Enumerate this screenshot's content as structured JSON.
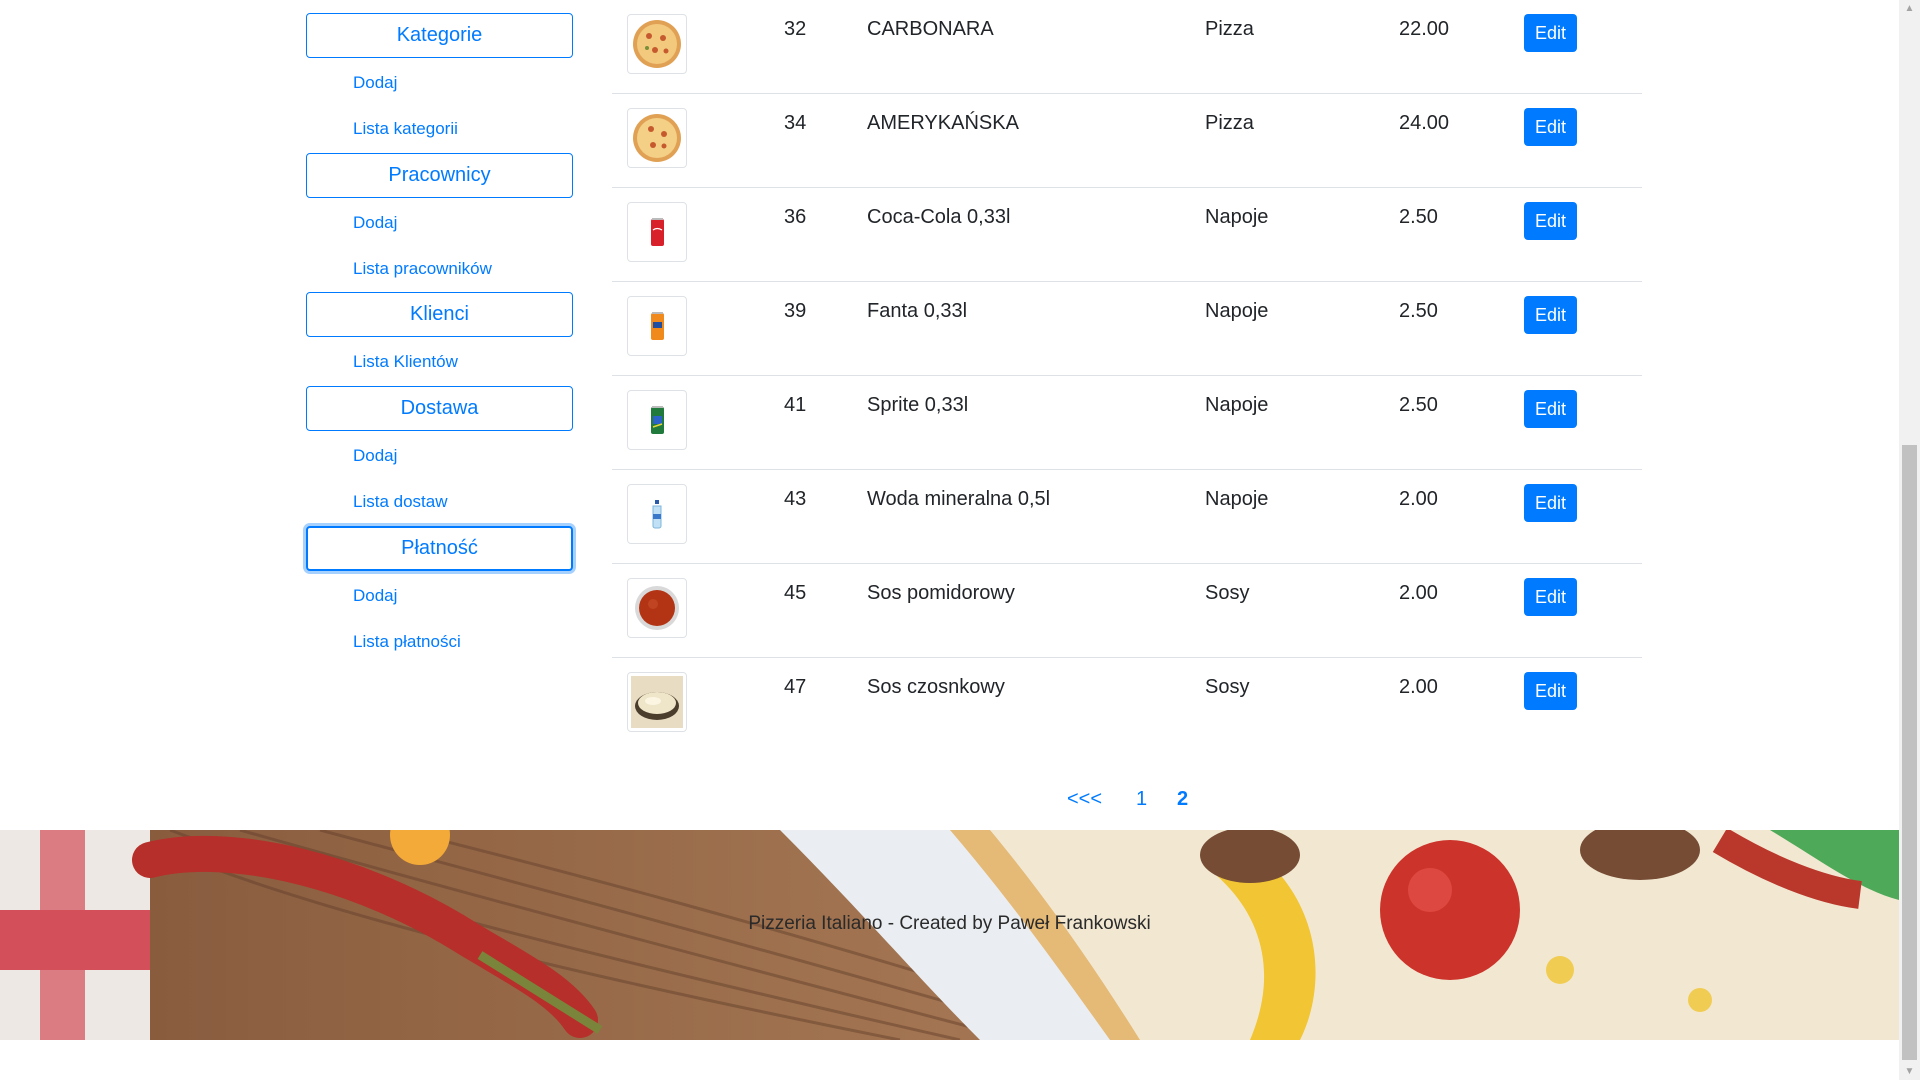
{
  "sidebar": {
    "sections": [
      {
        "label": "Kategorie",
        "links": [
          "Dodaj",
          "Lista kategorii"
        ]
      },
      {
        "label": "Pracownicy",
        "links": [
          "Dodaj",
          "Lista pracowników"
        ]
      },
      {
        "label": "Klienci",
        "links": [
          "Lista Klientów"
        ]
      },
      {
        "label": "Dostawa",
        "links": [
          "Dodaj",
          "Lista dostaw"
        ]
      },
      {
        "label": "Płatność",
        "links": [
          "Dodaj",
          "Lista płatności"
        ]
      }
    ]
  },
  "products": {
    "edit_label": "Edit",
    "rows": [
      {
        "id": "32",
        "name": "CARBONARA",
        "category": "Pizza",
        "price": "22.00",
        "image": "pizza"
      },
      {
        "id": "34",
        "name": "AMERYKAŃSKA",
        "category": "Pizza",
        "price": "24.00",
        "image": "pizza"
      },
      {
        "id": "36",
        "name": "Coca-Cola 0,33l",
        "category": "Napoje",
        "price": "2.50",
        "image": "coca-cola-can"
      },
      {
        "id": "39",
        "name": "Fanta 0,33l",
        "category": "Napoje",
        "price": "2.50",
        "image": "fanta-can"
      },
      {
        "id": "41",
        "name": "Sprite 0,33l",
        "category": "Napoje",
        "price": "2.50",
        "image": "sprite-can"
      },
      {
        "id": "43",
        "name": "Woda mineralna 0,5l",
        "category": "Napoje",
        "price": "2.00",
        "image": "water-bottle"
      },
      {
        "id": "45",
        "name": "Sos pomidorowy",
        "category": "Sosy",
        "price": "2.00",
        "image": "tomato-sauce"
      },
      {
        "id": "47",
        "name": "Sos czosnkowy",
        "category": "Sosy",
        "price": "2.00",
        "image": "garlic-sauce"
      }
    ]
  },
  "pagination": {
    "prev": "<<<",
    "pages": [
      "1",
      "2"
    ],
    "active": "2"
  },
  "footer": {
    "text": "Pizzeria Italiano - Created by Paweł Frankowski"
  },
  "colors": {
    "primary": "#007bff",
    "border": "#dee2e6",
    "text": "#212529"
  }
}
